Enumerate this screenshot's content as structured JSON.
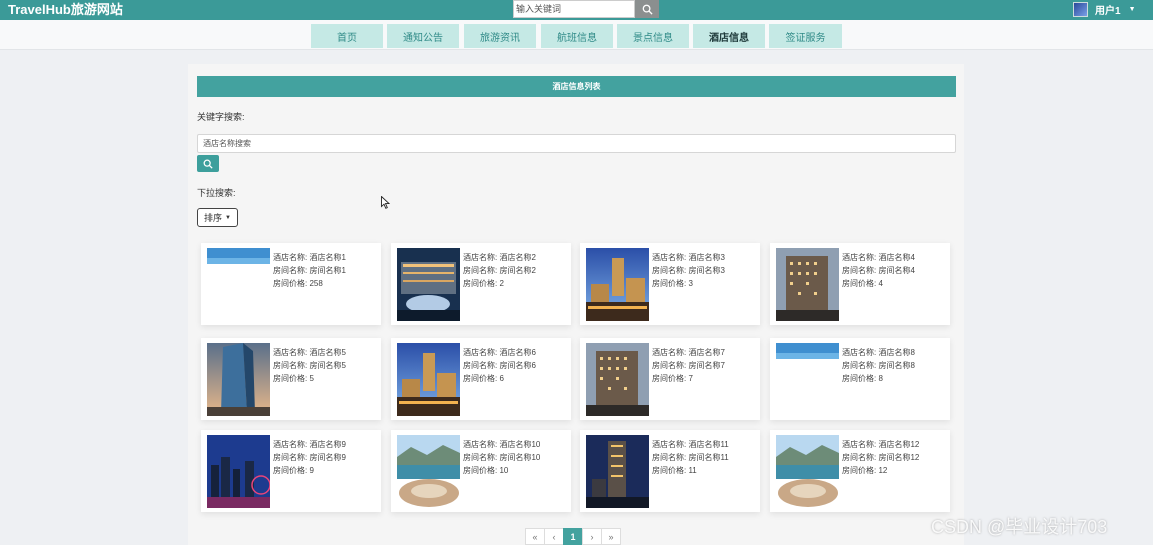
{
  "header": {
    "brand": "TravelHub旅游网站",
    "search_placeholder": "输入关键词",
    "user_label": "用户1"
  },
  "nav": [
    "首页",
    "通知公告",
    "旅游资讯",
    "航班信息",
    "景点信息",
    "酒店信息",
    "签证服务"
  ],
  "nav_active": "酒店信息",
  "list_title": "酒店信息列表",
  "keyword_label": "关键字搜索:",
  "keyword_placeholder": "酒店名称搜索",
  "dropdown_label": "下拉搜索:",
  "sort_label": "排序",
  "hotels": [
    {
      "name_line": "酒店名称: 酒店名称1",
      "room_line": "房间名称: 房间名称1",
      "price_line": "房间价格: 258",
      "image": "sky-banner"
    },
    {
      "name_line": "酒店名称: 酒店名称2",
      "room_line": "房间名称: 房间名称2",
      "price_line": "房间价格: 2",
      "image": "night-fountain"
    },
    {
      "name_line": "酒店名称: 酒店名称3",
      "room_line": "房间名称: 房间名称3",
      "price_line": "房间价格: 3",
      "image": "tower-dusk"
    },
    {
      "name_line": "酒店名称: 酒店名称4",
      "room_line": "房间名称: 房间名称4",
      "price_line": "房间价格: 4",
      "image": "building-dusk"
    },
    {
      "name_line": "酒店名称: 酒店名称5",
      "room_line": "房间名称: 房间名称5",
      "price_line": "房间价格: 5",
      "image": "glass-tower"
    },
    {
      "name_line": "酒店名称: 酒店名称6",
      "room_line": "房间名称: 房间名称6",
      "price_line": "房间价格: 6",
      "image": "tower-dusk"
    },
    {
      "name_line": "酒店名称: 酒店名称7",
      "room_line": "房间名称: 房间名称7",
      "price_line": "房间价格: 7",
      "image": "building-dusk"
    },
    {
      "name_line": "酒店名称: 酒店名称8",
      "room_line": "房间名称: 房间名称8",
      "price_line": "房间价格: 8",
      "image": "sky-banner"
    },
    {
      "name_line": "酒店名称: 酒店名称9",
      "room_line": "房间名称: 房间名称9",
      "price_line": "房间价格: 9",
      "image": "city-night"
    },
    {
      "name_line": "酒店名称: 酒店名称10",
      "room_line": "房间名称: 房间名称10",
      "price_line": "房间价格: 10",
      "image": "resort-coast"
    },
    {
      "name_line": "酒店名称: 酒店名称11",
      "room_line": "房间名称: 房间名称11",
      "price_line": "房间价格: 11",
      "image": "tower-night"
    },
    {
      "name_line": "酒店名称: 酒店名称12",
      "room_line": "房间名称: 房间名称12",
      "price_line": "房间价格: 12",
      "image": "resort-coast"
    }
  ],
  "pagination": [
    "«",
    "‹",
    "1",
    "›",
    "»"
  ],
  "current_page": "1",
  "watermark": "CSDN @毕业设计703",
  "colors": {
    "brand_teal": "#3b9a98",
    "nav_bg": "#c5e9e5",
    "header_bar": "#43a29f"
  }
}
